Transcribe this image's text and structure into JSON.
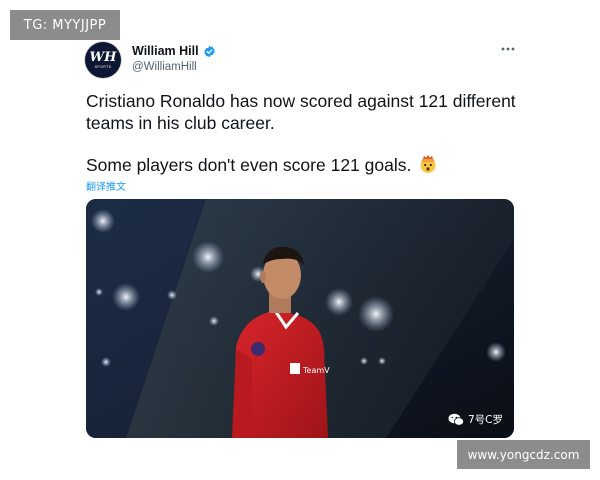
{
  "watermarks": {
    "top_left": "TG: MYYJJPP",
    "bottom_right": "www.yongcdz.com",
    "image_caption": "7号C罗"
  },
  "author": {
    "display_name": "William Hill",
    "handle": "@WilliamHill",
    "avatar_monogram": "WH",
    "avatar_sub": "SPORTS",
    "verified": true,
    "verified_color": "#1d9bf0"
  },
  "tweet": {
    "line1": "Cristiano Ronaldo has now scored against 121 different",
    "line2": "teams in his club career.",
    "line3": "Some players don't even score 121 goals.",
    "emoji": "exploding-head",
    "translate_label": "翻译推文"
  },
  "menu": {
    "more_icon": "more-horizontal-icon"
  },
  "colors": {
    "text": "#0f1419",
    "secondary": "#536471",
    "link": "#1d9bf0",
    "watermark_bg": "#8c8c8c"
  },
  "media": {
    "description_icon": "player-photo"
  }
}
